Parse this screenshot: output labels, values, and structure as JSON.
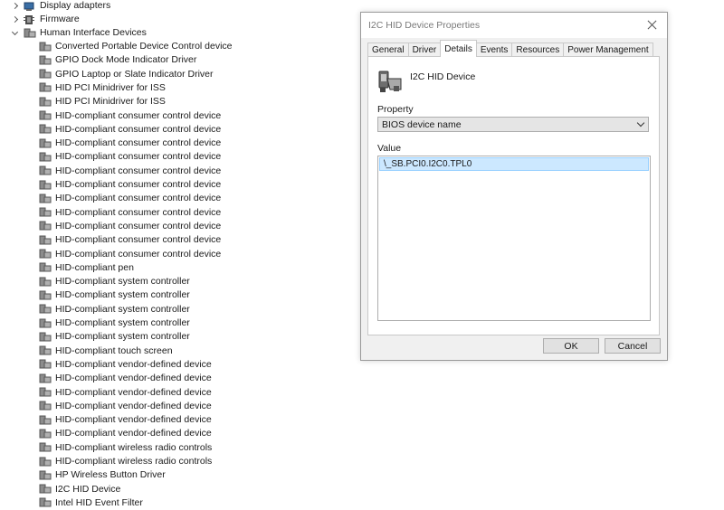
{
  "tree": {
    "categories": [
      {
        "label": "Display adapters",
        "state": "collapsed",
        "icon": "display-adapter-icon"
      },
      {
        "label": "Firmware",
        "state": "collapsed",
        "icon": "firmware-icon"
      },
      {
        "label": "Human Interface Devices",
        "state": "expanded",
        "icon": "hid-category-icon"
      }
    ],
    "hid_children": [
      "Converted Portable Device Control device",
      "GPIO Dock Mode Indicator Driver",
      "GPIO Laptop or Slate Indicator Driver",
      "HID PCI Minidriver for ISS",
      "HID PCI Minidriver for ISS",
      "HID-compliant consumer control device",
      "HID-compliant consumer control device",
      "HID-compliant consumer control device",
      "HID-compliant consumer control device",
      "HID-compliant consumer control device",
      "HID-compliant consumer control device",
      "HID-compliant consumer control device",
      "HID-compliant consumer control device",
      "HID-compliant consumer control device",
      "HID-compliant consumer control device",
      "HID-compliant consumer control device",
      "HID-compliant pen",
      "HID-compliant system controller",
      "HID-compliant system controller",
      "HID-compliant system controller",
      "HID-compliant system controller",
      "HID-compliant system controller",
      "HID-compliant touch screen",
      "HID-compliant vendor-defined device",
      "HID-compliant vendor-defined device",
      "HID-compliant vendor-defined device",
      "HID-compliant vendor-defined device",
      "HID-compliant vendor-defined device",
      "HID-compliant vendor-defined device",
      "HID-compliant wireless radio controls",
      "HID-compliant wireless radio controls",
      "HP Wireless Button Driver",
      "I2C HID Device",
      "Intel HID Event Filter"
    ]
  },
  "dialog": {
    "title": "I2C HID Device Properties",
    "tabs": [
      "General",
      "Driver",
      "Details",
      "Events",
      "Resources",
      "Power Management"
    ],
    "active_tab": "Details",
    "device_name": "I2C HID Device",
    "property_label": "Property",
    "property_selected": "BIOS device name",
    "value_label": "Value",
    "value_text": "\\_SB.PCI0.I2C0.TPL0",
    "ok_label": "OK",
    "cancel_label": "Cancel"
  }
}
